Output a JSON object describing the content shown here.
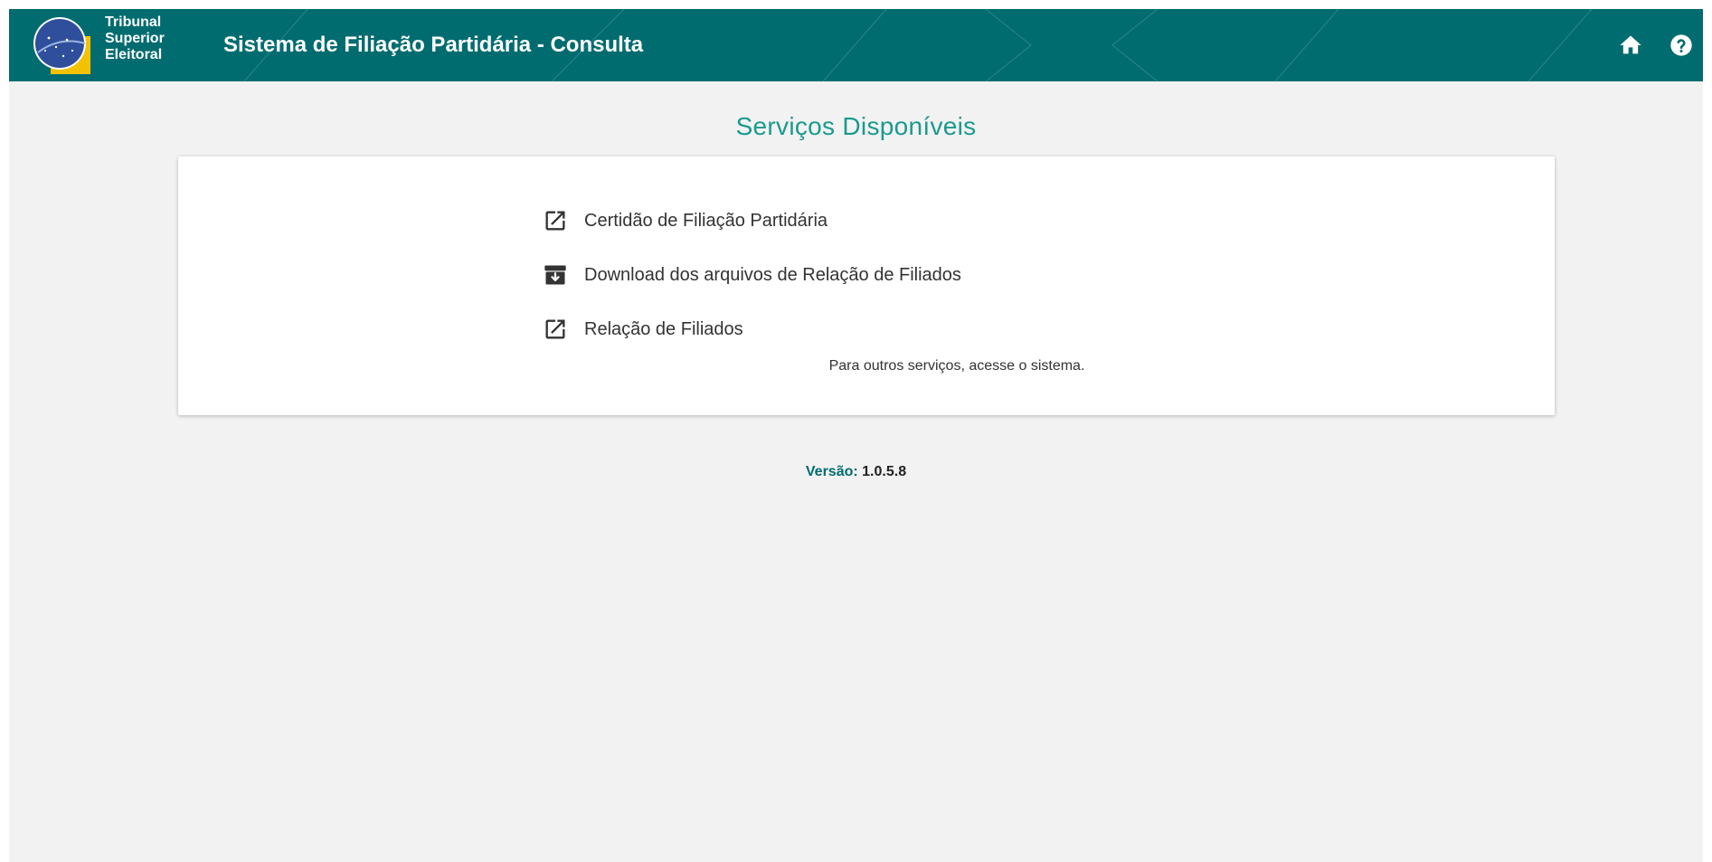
{
  "header": {
    "logo_lines": [
      "Tribunal",
      "Superior",
      "Eleitoral"
    ],
    "app_title": "Sistema de Filiação Partidária - Consulta",
    "icons": [
      "home-icon",
      "help-icon"
    ]
  },
  "main": {
    "title": "Serviços Disponíveis",
    "services": [
      {
        "label": "Certidão de Filiação Partidária",
        "icon": "external-link-icon"
      },
      {
        "label": "Download dos arquivos de Relação de Filiados",
        "icon": "archive-download-icon"
      },
      {
        "label": "Relação de Filiados",
        "icon": "external-link-icon"
      }
    ],
    "note": "Para outros serviços, acesse o sistema."
  },
  "footer": {
    "version_label": "Versão:",
    "version_value": "1.0.5.8"
  },
  "colors": {
    "header_bg": "#016c70",
    "title_teal": "#1a9a8e",
    "page_bg": "#f2f2f2"
  }
}
